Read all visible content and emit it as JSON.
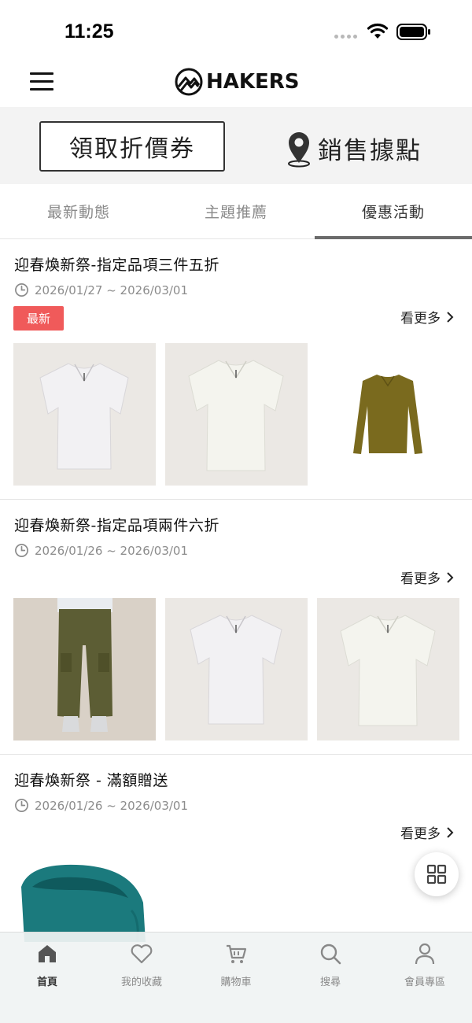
{
  "status_bar": {
    "time": "11:25"
  },
  "header": {
    "brand_name": "HAKERS",
    "menu_icon": "hamburger-menu-icon",
    "logo_icon": "mountain-logo-icon"
  },
  "actions": {
    "coupon_label": "領取折價券",
    "store_label": "銷售據點",
    "store_icon": "location-pin-icon"
  },
  "tabs": [
    {
      "label": "最新動態",
      "active": false
    },
    {
      "label": "主題推薦",
      "active": false
    },
    {
      "label": "優惠活動",
      "active": true
    }
  ],
  "promotions": [
    {
      "title": "迎春煥新祭-指定品項三件五折",
      "date_range": "2026/01/27 ~ 2026/03/01",
      "badge": "最新",
      "more_label": "看更多",
      "products": [
        "white short-sleeve zip tee",
        "ivory short-sleeve zip tee",
        "olive long-sleeve henley"
      ]
    },
    {
      "title": "迎春煥新祭-指定品項兩件六折",
      "date_range": "2026/01/26 ~ 2026/03/01",
      "badge": "",
      "more_label": "看更多",
      "products": [
        "olive cargo pants",
        "white short-sleeve zip tee",
        "ivory short-sleeve zip tee"
      ]
    },
    {
      "title": "迎春煥新祭 - 滿額贈送",
      "date_range": "2026/01/26 ~ 2026/03/01",
      "badge": "",
      "more_label": "看更多",
      "products": [
        "teal fleece neck gaiter"
      ]
    }
  ],
  "bottom_nav": [
    {
      "label": "首頁",
      "icon": "home-icon",
      "active": true
    },
    {
      "label": "我的收藏",
      "icon": "heart-icon",
      "active": false
    },
    {
      "label": "購物車",
      "icon": "cart-icon",
      "active": false
    },
    {
      "label": "搜尋",
      "icon": "search-icon",
      "active": false
    },
    {
      "label": "會員專區",
      "icon": "user-icon",
      "active": false
    }
  ],
  "colors": {
    "badge_red": "#f05a5a",
    "tab_indicator": "#6b6b6b",
    "band_gray": "#f3f3f3"
  }
}
